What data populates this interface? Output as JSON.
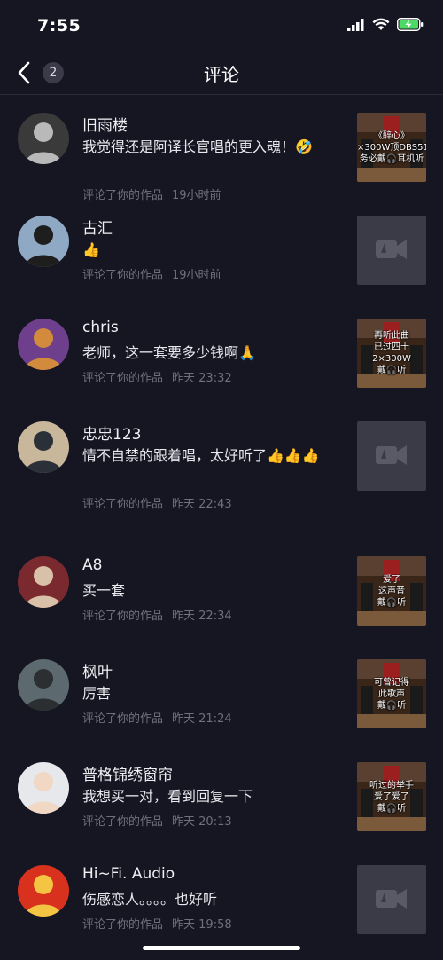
{
  "status": {
    "time": "7:55"
  },
  "nav": {
    "title": "评论",
    "back_badge": "2"
  },
  "comments": [
    {
      "name": "旧雨楼",
      "text": "我觉得还是阿译长官唱的更入魂！🤣",
      "action": "评论了你的作品",
      "time": "19小时前",
      "thumb": {
        "kind": "video",
        "lines": [
          "《醉心》",
          "×300W顶DBS51",
          "务必戴🎧耳机听"
        ]
      }
    },
    {
      "name": "古汇",
      "text": "👍",
      "action": "评论了你的作品",
      "time": "19小时前",
      "thumb": {
        "kind": "placeholder",
        "lines": []
      }
    },
    {
      "name": "chris",
      "text": "老师，这一套要多少钱啊🙏",
      "action": "评论了你的作品",
      "time": "昨天 23:32",
      "thumb": {
        "kind": "video",
        "lines": [
          "再听此曲",
          "已过四十",
          "2×300W",
          "戴🎧听"
        ]
      }
    },
    {
      "name": "忠忠123",
      "text": "情不自禁的跟着唱，太好听了👍👍👍",
      "action": "评论了你的作品",
      "time": "昨天 22:43",
      "thumb": {
        "kind": "placeholder",
        "lines": []
      }
    },
    {
      "name": "A8",
      "text": "买一套",
      "action": "评论了你的作品",
      "time": "昨天 22:34",
      "thumb": {
        "kind": "video",
        "lines": [
          "爱了",
          "这声音",
          "戴🎧听"
        ]
      }
    },
    {
      "name": "枫叶",
      "text": "厉害",
      "action": "评论了你的作品",
      "time": "昨天 21:24",
      "thumb": {
        "kind": "video",
        "lines": [
          "可曾记得",
          "此歌声",
          "戴🎧听"
        ]
      }
    },
    {
      "name": "普格锦绣窗帘",
      "text": "我想买一对，看到回复一下",
      "action": "评论了你的作品",
      "time": "昨天 20:13",
      "thumb": {
        "kind": "video",
        "lines": [
          "听过的举手",
          "爱了爱了",
          "戴🎧听"
        ]
      }
    },
    {
      "name": "Hi~Fi. Audio",
      "text": "伤感恋人。。。。也好听",
      "action": "评论了你的作品",
      "time": "昨天 19:58",
      "thumb": {
        "kind": "placeholder",
        "lines": []
      }
    }
  ],
  "icons": {
    "back": "chevron-left-icon",
    "signal": "signal-icon",
    "wifi": "wifi-icon",
    "battery": "battery-charging-icon",
    "video_placeholder": "video-camera-icon"
  },
  "colors": {
    "background": "#161622",
    "meta_text": "#6f6f7e",
    "battery": "#4cd964"
  }
}
